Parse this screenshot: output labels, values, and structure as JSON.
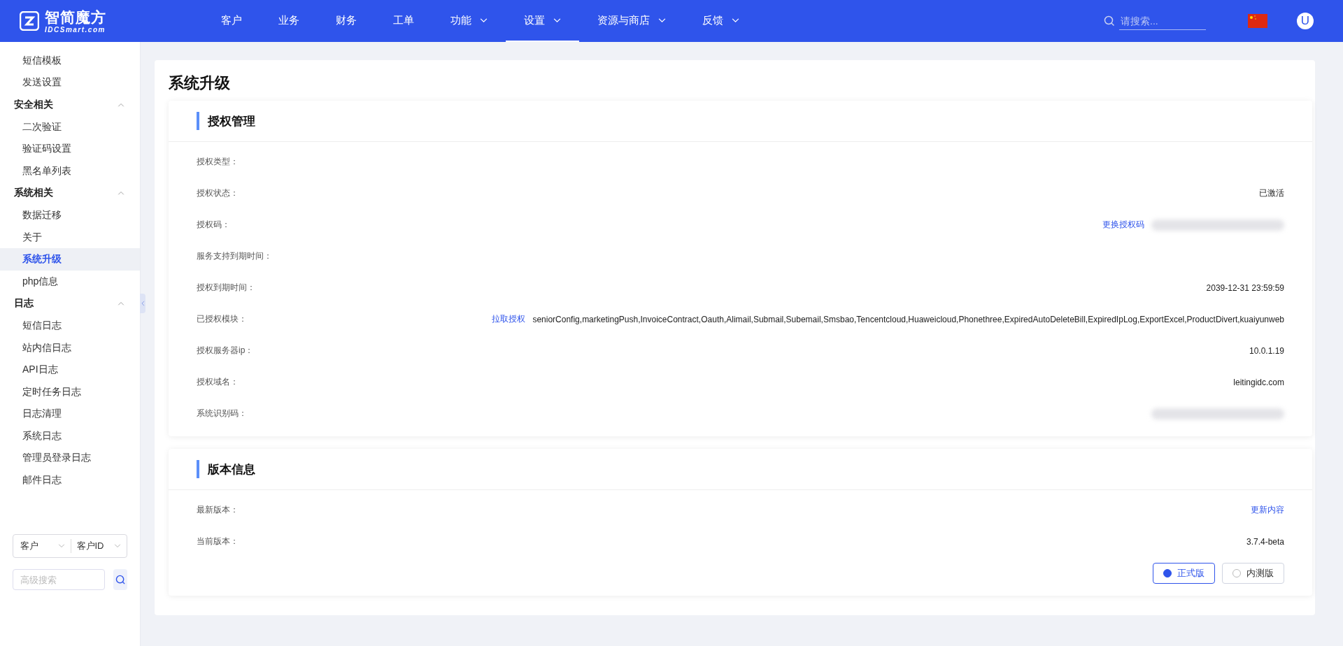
{
  "header": {
    "logo_title": "智简魔方",
    "logo_subtitle": "IDCSmart.com",
    "nav": [
      {
        "label": "客户",
        "dropdown": false,
        "selected": false
      },
      {
        "label": "业务",
        "dropdown": false,
        "selected": false
      },
      {
        "label": "财务",
        "dropdown": false,
        "selected": false
      },
      {
        "label": "工单",
        "dropdown": false,
        "selected": false
      },
      {
        "label": "功能",
        "dropdown": true,
        "selected": false
      },
      {
        "label": "设置",
        "dropdown": true,
        "selected": true
      },
      {
        "label": "资源与商店",
        "dropdown": true,
        "selected": false
      },
      {
        "label": "反馈",
        "dropdown": true,
        "selected": false
      }
    ],
    "search": {
      "placeholder": "请搜索..."
    },
    "avatar": "U"
  },
  "sidebar": {
    "items": [
      {
        "kind": "item",
        "label": "短信模板",
        "selected": false
      },
      {
        "kind": "item",
        "label": "发送设置",
        "selected": false
      },
      {
        "kind": "group",
        "label": "安全相关",
        "expanded": true,
        "children": [
          {
            "label": "二次验证",
            "selected": false
          },
          {
            "label": "验证码设置",
            "selected": false
          },
          {
            "label": "黑名单列表",
            "selected": false
          }
        ]
      },
      {
        "kind": "group",
        "label": "系统相关",
        "expanded": true,
        "children": [
          {
            "label": "数据迁移",
            "selected": false
          },
          {
            "label": "关于",
            "selected": false
          },
          {
            "label": "系统升级",
            "selected": true
          },
          {
            "label": "php信息",
            "selected": false
          }
        ]
      },
      {
        "kind": "group",
        "label": "日志",
        "expanded": true,
        "children": [
          {
            "label": "短信日志",
            "selected": false
          },
          {
            "label": "站内信日志",
            "selected": false
          },
          {
            "label": "API日志",
            "selected": false
          },
          {
            "label": "定时任务日志",
            "selected": false
          },
          {
            "label": "日志清理",
            "selected": false
          },
          {
            "label": "系统日志",
            "selected": false
          },
          {
            "label": "管理员登录日志",
            "selected": false
          },
          {
            "label": "邮件日志",
            "selected": false
          }
        ]
      }
    ],
    "filter": {
      "selects": [
        "客户",
        "客户ID"
      ],
      "search_placeholder": "高级搜索"
    }
  },
  "page": {
    "title": "系统升级",
    "license": {
      "title": "授权管理",
      "rows": [
        {
          "label": "授权类型："
        },
        {
          "label": "授权状态：",
          "value": "已激活"
        },
        {
          "label": "授权码：",
          "link": "更换授权码",
          "redacted": true
        },
        {
          "label": "服务支持到期时间："
        },
        {
          "label": "授权到期时间：",
          "value": "2039-12-31 23:59:59"
        },
        {
          "label": "已授权模块：",
          "link": "拉取授权",
          "value": "seniorConfig,marketingPush,InvoiceContract,Oauth,Alimail,Submail,Subemail,Smsbao,Tencentcloud,Huaweicloud,Phonethree,ExpiredAutoDeleteBill,ExpiredIpLog,ExportExcel,ProductDivert,kuaiyunweb"
        },
        {
          "label": "授权服务器ip：",
          "value": "10.0.1.19"
        },
        {
          "label": "授权域名：",
          "value": "leitingidc.com"
        },
        {
          "label": "系统识别码：",
          "redacted": true
        }
      ]
    },
    "version": {
      "title": "版本信息",
      "rows": [
        {
          "kind": "text",
          "label": "最新版本：",
          "link": "更新内容"
        },
        {
          "kind": "text",
          "label": "当前版本：",
          "value": "3.7.4-beta"
        },
        {
          "kind": "radio",
          "options": [
            {
              "label": "正式版",
              "selected": true
            },
            {
              "label": "内测版",
              "selected": false
            }
          ]
        }
      ]
    }
  }
}
